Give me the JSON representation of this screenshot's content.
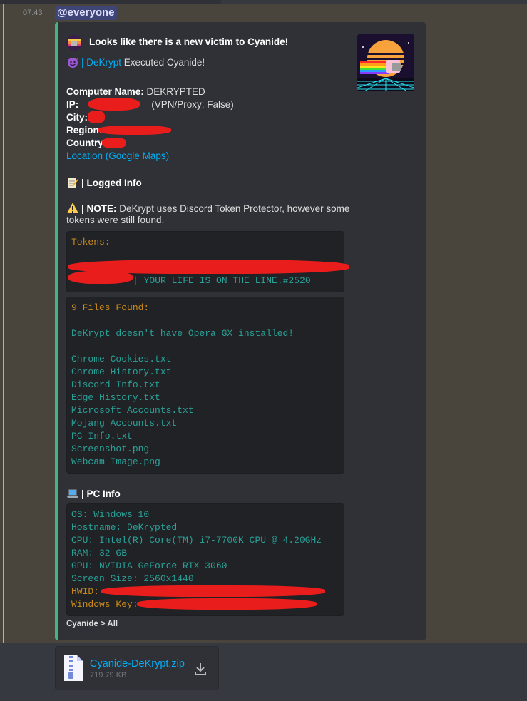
{
  "message": {
    "timestamp": "07:43",
    "mention": "@everyone"
  },
  "embed": {
    "author": "Looks like there is a new victim to Cyanide!",
    "executed": {
      "username": "DeKrypt",
      "text": " Executed Cyanide!",
      "prefix": "| "
    },
    "fields": {
      "computer_name_label": "Computer Name:",
      "computer_name_value": " DEKRYPTED",
      "ip_label": "IP:",
      "ip_suffix": "(VPN/Proxy: False)",
      "city_label": "City:",
      "region_label": "Region:",
      "country_label": "Country:",
      "location_link": "Location (Google Maps)"
    },
    "logged_info_title": "| Logged Info",
    "note_label": "| NOTE:",
    "note_text_1": " DeKrypt uses Discord Token Protector, however some",
    "note_text_2": "tokens were still found.",
    "tokens": {
      "header": "Tokens:",
      "entry_suffix": "| YOUR LIFE IS ON THE LINE.#2520"
    },
    "files": {
      "header": "9 Files Found:",
      "opera_note": "DeKrypt doesn't have Opera GX installed!",
      "list": [
        "Chrome Cookies.txt",
        "Chrome History.txt",
        "Discord Info.txt",
        "Edge History.txt",
        "Microsoft Accounts.txt",
        "Mojang Accounts.txt",
        "PC Info.txt",
        "Screenshot.png",
        "Webcam Image.png"
      ]
    },
    "pc_info_title": "| PC Info",
    "pc_info": {
      "os": "OS: Windows 10",
      "hostname": "Hostname: DeKrypted",
      "cpu": "CPU: Intel(R) Core(TM) i7-7700K CPU @ 4.20GHz",
      "ram": "RAM: 32 GB",
      "gpu": "GPU: NVIDIA GeForce RTX 3060",
      "screen": "Screen Size: 2560x1440",
      "hwid": "HWID:",
      "windows_key": "Windows Key:"
    },
    "footer": "Cyanide > All"
  },
  "attachment": {
    "file_name": "Cyanide-DeKrypt.zip",
    "file_size": "719.79 KB"
  },
  "icons": {
    "author_icon": "cyanide-logo-icon",
    "thumbnail": "nyan-cat-synthwave-thumbnail",
    "emoji_devil": "smiling-imp-emoji",
    "emoji_memo": "memo-emoji",
    "emoji_warning": "warning-emoji",
    "emoji_laptop": "laptop-emoji",
    "file_icon": "zip-file-icon",
    "download_icon": "download-icon"
  },
  "colors": {
    "background": "#36393f",
    "message_highlight": "#49443c",
    "mention_accent": "#faa81a",
    "embed_background": "#2f3136",
    "embed_bar": "#43b581",
    "code_orange": "#cb8a1a",
    "code_teal": "#2aa198",
    "link": "#00aff4",
    "redaction": "#ea1d1d"
  }
}
